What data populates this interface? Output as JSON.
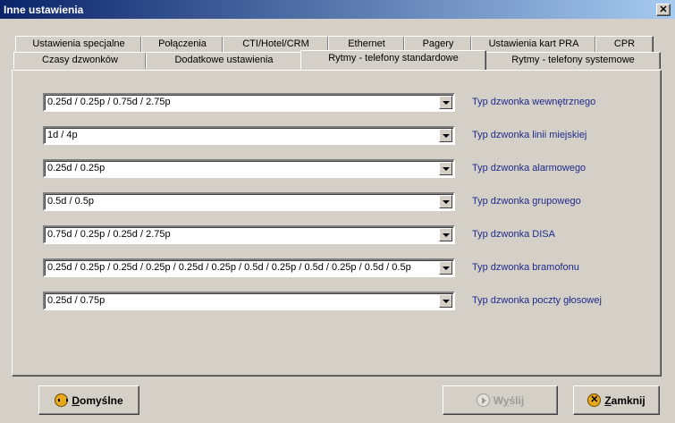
{
  "window": {
    "title": "Inne ustawienia",
    "close_glyph": "✕"
  },
  "tabs_row1": [
    "Ustawienia specjalne",
    "Połączenia",
    "CTI/Hotel/CRM",
    "Ethernet",
    "Pagery",
    "Ustawienia kart PRA",
    "CPR"
  ],
  "tabs_row2": [
    "Czasy dzwonków",
    "Dodatkowe ustawienia",
    "Rytmy - telefony standardowe",
    "Rytmy - telefony systemowe"
  ],
  "active_tab": "Rytmy - telefony standardowe",
  "rows": [
    {
      "value": "0.25d / 0.25p / 0.75d / 2.75p",
      "label": "Typ dzwonka wewnętrznego"
    },
    {
      "value": "1d / 4p",
      "label": "Typ dzwonka linii miejskiej"
    },
    {
      "value": "0.25d / 0.25p",
      "label": "Typ dzwonka alarmowego"
    },
    {
      "value": "0.5d / 0.5p",
      "label": "Typ dzwonka grupowego"
    },
    {
      "value": "0.75d / 0.25p / 0.25d / 2.75p",
      "label": "Typ dzwonka DISA"
    },
    {
      "value": "0.25d / 0.25p / 0.25d / 0.25p / 0.25d / 0.25p / 0.5d / 0.25p / 0.5d / 0.25p / 0.5d / 0.5p",
      "label": "Typ dzwonka bramofonu"
    },
    {
      "value": "0.25d / 0.75p",
      "label": "Typ dzwonka poczty głosowej"
    }
  ],
  "buttons": {
    "default": {
      "accel": "D",
      "rest": "omyślne"
    },
    "send": {
      "first": "W",
      "accel": "y",
      "rest": "ślij",
      "enabled": false
    },
    "close": {
      "accel": "Z",
      "rest": "amknij"
    }
  },
  "colors": {
    "title_start": "#0a246a",
    "title_end": "#a6caf0",
    "label": "#1f2a8a",
    "face": "#d4d0c8"
  }
}
